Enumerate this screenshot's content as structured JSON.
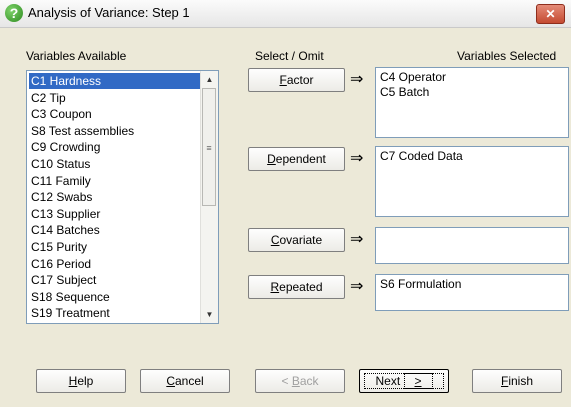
{
  "window": {
    "title": "Analysis of Variance: Step 1",
    "close_glyph": "✕",
    "app_icon": "?"
  },
  "labels": {
    "variables_available": "Variables Available",
    "select_omit": "Select / Omit",
    "variables_selected": "Variables Selected"
  },
  "available_list": {
    "selected": "C1 Hardness",
    "items": [
      "C1 Hardness",
      "C2 Tip",
      "C3 Coupon",
      "S8 Test assemblies",
      "C9 Crowding",
      "C10 Status",
      "C11 Family",
      "C12 Swabs",
      "C13 Supplier",
      "C14 Batches",
      "C15 Purity",
      "C16 Period",
      "C17 Subject",
      "S18 Sequence",
      "S19 Treatment"
    ]
  },
  "selectors": [
    {
      "key": "F",
      "rest": "actor",
      "items": [
        "C4 Operator",
        "C5 Batch"
      ]
    },
    {
      "key": "D",
      "rest": "ependent",
      "items": [
        "C7 Coded Data"
      ]
    },
    {
      "key": "C",
      "rest": "ovariate",
      "items": []
    },
    {
      "key": "R",
      "rest": "epeated",
      "items": [
        "S6 Formulation"
      ]
    }
  ],
  "footer": {
    "help": {
      "key": "H",
      "rest": "elp"
    },
    "cancel": {
      "key": "C",
      "rest": "ancel"
    },
    "back": {
      "pre": "< ",
      "key": "B",
      "rest": "ack"
    },
    "next": {
      "pre": "Next ",
      "key": ">",
      "rest": ""
    },
    "finish": {
      "key": "F",
      "rest": "inish"
    }
  },
  "arrow_glyph": "⇒"
}
